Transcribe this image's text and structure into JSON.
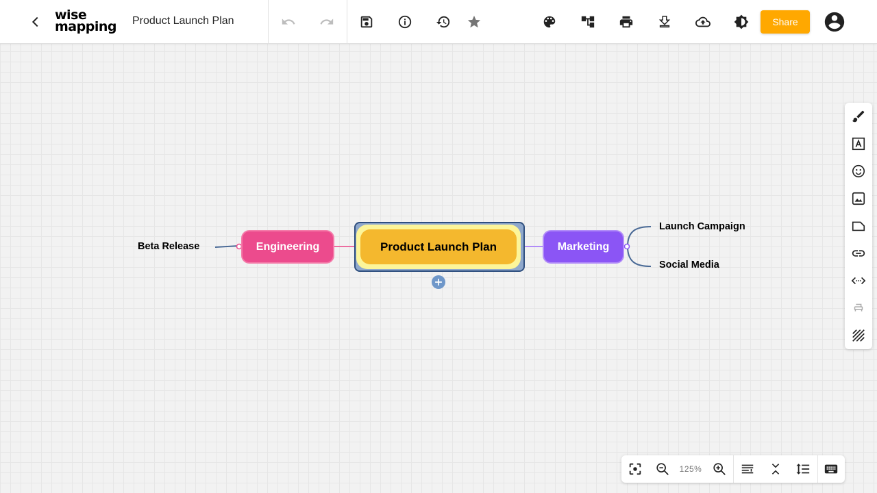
{
  "app": {
    "logo_line1": "wise",
    "logo_line2": "mapping"
  },
  "document": {
    "title": "Product Launch Plan"
  },
  "toolbar": {
    "back_icon": "chevron-left-icon",
    "actions": [
      "undo",
      "redo",
      "save",
      "info",
      "history",
      "star",
      "theme-palette",
      "layout",
      "print",
      "download",
      "publish",
      "contrast"
    ],
    "share_label": "Share",
    "account_icon": "account-circle-icon"
  },
  "mindmap": {
    "central": {
      "label": "Product Launch Plan",
      "color": "#f4b82e"
    },
    "left_branch": {
      "label": "Engineering",
      "color": "#ec4b8d",
      "children": [
        "Beta Release"
      ]
    },
    "right_branch": {
      "label": "Marketing",
      "color": "#8b55f5",
      "children": [
        "Launch Campaign",
        "Social Media"
      ]
    }
  },
  "side_tools": [
    "brush",
    "font",
    "emoji",
    "image",
    "note",
    "link",
    "relationship",
    "topic-style",
    "pattern"
  ],
  "zoom": {
    "level": "125%"
  },
  "colors": {
    "share_button": "#ffa800",
    "connector": "#4a6a96"
  }
}
